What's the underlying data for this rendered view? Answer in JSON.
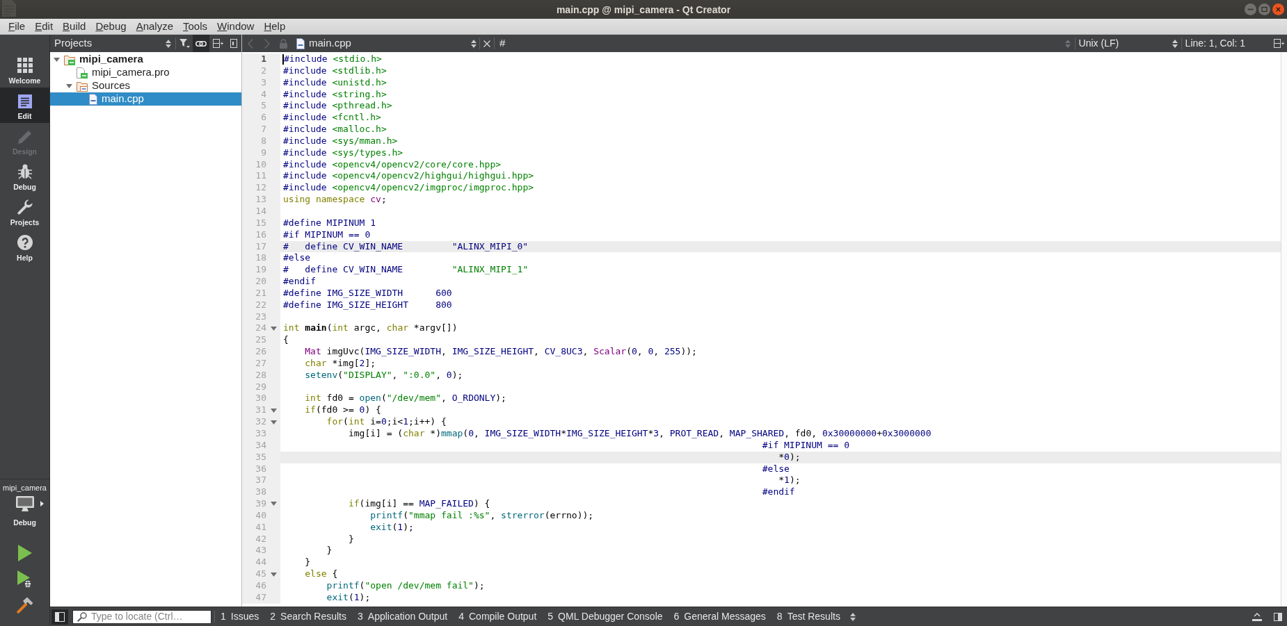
{
  "window": {
    "title": "main.cpp @ mipi_camera - Qt Creator"
  },
  "menu": [
    "File",
    "Edit",
    "Build",
    "Debug",
    "Analyze",
    "Tools",
    "Window",
    "Help"
  ],
  "mode_bar": {
    "modes": [
      {
        "label": "Welcome",
        "kind": "welcome",
        "selected": false,
        "disabled": false
      },
      {
        "label": "Edit",
        "kind": "edit",
        "selected": true,
        "disabled": false
      },
      {
        "label": "Design",
        "kind": "design",
        "selected": false,
        "disabled": true
      },
      {
        "label": "Debug",
        "kind": "debug",
        "selected": false,
        "disabled": false
      },
      {
        "label": "Projects",
        "kind": "projects",
        "selected": false,
        "disabled": false
      },
      {
        "label": "Help",
        "kind": "help",
        "selected": false,
        "disabled": false
      }
    ],
    "kit": {
      "project": "mipi_camera",
      "build": "Debug"
    }
  },
  "projects_panel": {
    "view": "Projects",
    "link_button": {
      "checked": true
    },
    "tree": [
      {
        "label": "mipi_camera",
        "kind": "project",
        "expanded": true,
        "selected": false,
        "children": [
          {
            "label": "mipi_camera.pro",
            "kind": "qmake",
            "selected": false
          },
          {
            "label": "Sources",
            "kind": "folder",
            "expanded": true,
            "selected": false,
            "children": [
              {
                "label": "main.cpp",
                "kind": "source",
                "selected": true
              }
            ]
          }
        ]
      }
    ]
  },
  "editor": {
    "document": "main.cpp",
    "symbol": "#",
    "line_ending": "Unix (LF)",
    "position": "Line: 1, Col: 1",
    "back": {
      "disabled": true
    },
    "forward": {
      "disabled": true
    },
    "lines": [
      {
        "number": "1",
        "current": true,
        "disabled": false,
        "foldable": false,
        "tokens": [
          {
            "kind": "preprocessor",
            "text": "#include "
          },
          {
            "kind": "string",
            "text": "<stdio.h>"
          }
        ]
      },
      {
        "number": "2",
        "current": false,
        "disabled": false,
        "foldable": false,
        "tokens": [
          {
            "kind": "preprocessor",
            "text": "#include "
          },
          {
            "kind": "string",
            "text": "<stdlib.h>"
          }
        ]
      },
      {
        "number": "3",
        "current": false,
        "disabled": false,
        "foldable": false,
        "tokens": [
          {
            "kind": "preprocessor",
            "text": "#include "
          },
          {
            "kind": "string",
            "text": "<unistd.h>"
          }
        ]
      },
      {
        "number": "4",
        "current": false,
        "disabled": false,
        "foldable": false,
        "tokens": [
          {
            "kind": "preprocessor",
            "text": "#include "
          },
          {
            "kind": "string",
            "text": "<string.h>"
          }
        ]
      },
      {
        "number": "5",
        "current": false,
        "disabled": false,
        "foldable": false,
        "tokens": [
          {
            "kind": "preprocessor",
            "text": "#include "
          },
          {
            "kind": "string",
            "text": "<pthread.h>"
          }
        ]
      },
      {
        "number": "6",
        "current": false,
        "disabled": false,
        "foldable": false,
        "tokens": [
          {
            "kind": "preprocessor",
            "text": "#include "
          },
          {
            "kind": "string",
            "text": "<fcntl.h>"
          }
        ]
      },
      {
        "number": "7",
        "current": false,
        "disabled": false,
        "foldable": false,
        "tokens": [
          {
            "kind": "preprocessor",
            "text": "#include "
          },
          {
            "kind": "string",
            "text": "<malloc.h>"
          }
        ]
      },
      {
        "number": "8",
        "current": false,
        "disabled": false,
        "foldable": false,
        "tokens": [
          {
            "kind": "preprocessor",
            "text": "#include "
          },
          {
            "kind": "string",
            "text": "<sys/mman.h>"
          }
        ]
      },
      {
        "number": "9",
        "current": false,
        "disabled": false,
        "foldable": false,
        "tokens": [
          {
            "kind": "preprocessor",
            "text": "#include "
          },
          {
            "kind": "string",
            "text": "<sys/types.h>"
          }
        ]
      },
      {
        "number": "10",
        "current": false,
        "disabled": false,
        "foldable": false,
        "tokens": [
          {
            "kind": "preprocessor",
            "text": "#include "
          },
          {
            "kind": "string",
            "text": "<opencv4/opencv2/core/core.hpp>"
          }
        ]
      },
      {
        "number": "11",
        "current": false,
        "disabled": false,
        "foldable": false,
        "tokens": [
          {
            "kind": "preprocessor",
            "text": "#include "
          },
          {
            "kind": "string",
            "text": "<opencv4/opencv2/highgui/highgui.hpp>"
          }
        ]
      },
      {
        "number": "12",
        "current": false,
        "disabled": false,
        "foldable": false,
        "tokens": [
          {
            "kind": "preprocessor",
            "text": "#include "
          },
          {
            "kind": "string",
            "text": "<opencv4/opencv2/imgproc/imgproc.hpp>"
          }
        ]
      },
      {
        "number": "13",
        "current": false,
        "disabled": false,
        "foldable": false,
        "tokens": [
          {
            "kind": "keyword",
            "text": "using namespace "
          },
          {
            "kind": "type",
            "text": "cv"
          },
          {
            "kind": "plain",
            "text": ";"
          }
        ]
      },
      {
        "number": "14",
        "current": false,
        "disabled": false,
        "foldable": false
      },
      {
        "number": "15",
        "current": false,
        "disabled": false,
        "foldable": false,
        "tokens": [
          {
            "kind": "preprocessor",
            "text": "#define MIPINUM 1"
          }
        ]
      },
      {
        "number": "16",
        "current": false,
        "disabled": false,
        "foldable": false,
        "tokens": [
          {
            "kind": "preprocessor",
            "text": "#if MIPINUM == 0"
          }
        ]
      },
      {
        "number": "17",
        "current": false,
        "disabled": true,
        "foldable": false,
        "tokens": [
          {
            "kind": "preprocessor",
            "text": "#   define CV_WIN_NAME         \"ALINX_MIPI_0\""
          }
        ]
      },
      {
        "number": "18",
        "current": false,
        "disabled": false,
        "foldable": false,
        "tokens": [
          {
            "kind": "preprocessor",
            "text": "#else"
          }
        ]
      },
      {
        "number": "19",
        "current": false,
        "disabled": false,
        "foldable": false,
        "tokens": [
          {
            "kind": "preprocessor",
            "text": "#   define CV_WIN_NAME         "
          },
          {
            "kind": "string",
            "text": "\"ALINX_MIPI_1\""
          }
        ]
      },
      {
        "number": "20",
        "current": false,
        "disabled": false,
        "foldable": false,
        "tokens": [
          {
            "kind": "preprocessor",
            "text": "#endif"
          }
        ]
      },
      {
        "number": "21",
        "current": false,
        "disabled": false,
        "foldable": false,
        "tokens": [
          {
            "kind": "preprocessor",
            "text": "#define IMG_SIZE_WIDTH      600"
          }
        ]
      },
      {
        "number": "22",
        "current": false,
        "disabled": false,
        "foldable": false,
        "tokens": [
          {
            "kind": "preprocessor",
            "text": "#define IMG_SIZE_HEIGHT     800"
          }
        ]
      },
      {
        "number": "23",
        "current": false,
        "disabled": false,
        "foldable": false
      },
      {
        "number": "24",
        "current": false,
        "disabled": false,
        "foldable": true,
        "tokens": [
          {
            "kind": "keyword",
            "text": "int "
          },
          {
            "kind": "declaration",
            "text": "main"
          },
          {
            "kind": "plain",
            "text": "("
          },
          {
            "kind": "keyword",
            "text": "int"
          },
          {
            "kind": "plain",
            "text": " argc, "
          },
          {
            "kind": "keyword",
            "text": "char"
          },
          {
            "kind": "plain",
            "text": " *argv[])"
          }
        ]
      },
      {
        "number": "25",
        "current": false,
        "disabled": false,
        "foldable": false,
        "tokens": [
          {
            "kind": "plain",
            "text": "{"
          }
        ]
      },
      {
        "number": "26",
        "current": false,
        "disabled": false,
        "foldable": false,
        "tokens": [
          {
            "kind": "type",
            "text": "    Mat"
          },
          {
            "kind": "plain",
            "text": " imgUvc("
          },
          {
            "kind": "preprocessor",
            "text": "IMG_SIZE_WIDTH"
          },
          {
            "kind": "plain",
            "text": ", "
          },
          {
            "kind": "preprocessor",
            "text": "IMG_SIZE_HEIGHT"
          },
          {
            "kind": "plain",
            "text": ", "
          },
          {
            "kind": "preprocessor",
            "text": "CV_8UC3"
          },
          {
            "kind": "plain",
            "text": ", "
          },
          {
            "kind": "type",
            "text": "Scalar"
          },
          {
            "kind": "plain",
            "text": "("
          },
          {
            "kind": "number",
            "text": "0"
          },
          {
            "kind": "plain",
            "text": ", "
          },
          {
            "kind": "number",
            "text": "0"
          },
          {
            "kind": "plain",
            "text": ", "
          },
          {
            "kind": "number",
            "text": "255"
          },
          {
            "kind": "plain",
            "text": "));"
          }
        ]
      },
      {
        "number": "27",
        "current": false,
        "disabled": false,
        "foldable": false,
        "tokens": [
          {
            "kind": "keyword",
            "text": "    char"
          },
          {
            "kind": "plain",
            "text": " *img["
          },
          {
            "kind": "number",
            "text": "2"
          },
          {
            "kind": "plain",
            "text": "];"
          }
        ]
      },
      {
        "number": "28",
        "current": false,
        "disabled": false,
        "foldable": false,
        "tokens": [
          {
            "kind": "function",
            "text": "    setenv"
          },
          {
            "kind": "plain",
            "text": "("
          },
          {
            "kind": "string",
            "text": "\"DISPLAY\""
          },
          {
            "kind": "plain",
            "text": ", "
          },
          {
            "kind": "string",
            "text": "\":0.0\""
          },
          {
            "kind": "plain",
            "text": ", "
          },
          {
            "kind": "number",
            "text": "0"
          },
          {
            "kind": "plain",
            "text": ");"
          }
        ]
      },
      {
        "number": "29",
        "current": false,
        "disabled": false,
        "foldable": false
      },
      {
        "number": "30",
        "current": false,
        "disabled": false,
        "foldable": false,
        "tokens": [
          {
            "kind": "keyword",
            "text": "    int"
          },
          {
            "kind": "plain",
            "text": " fd0 = "
          },
          {
            "kind": "function",
            "text": "open"
          },
          {
            "kind": "plain",
            "text": "("
          },
          {
            "kind": "string",
            "text": "\"/dev/mem\""
          },
          {
            "kind": "plain",
            "text": ", "
          },
          {
            "kind": "preprocessor",
            "text": "O_RDONLY"
          },
          {
            "kind": "plain",
            "text": ");"
          }
        ]
      },
      {
        "number": "31",
        "current": false,
        "disabled": false,
        "foldable": true,
        "tokens": [
          {
            "kind": "keyword",
            "text": "    if"
          },
          {
            "kind": "plain",
            "text": "(fd0 >= "
          },
          {
            "kind": "number",
            "text": "0"
          },
          {
            "kind": "plain",
            "text": ") {"
          }
        ]
      },
      {
        "number": "32",
        "current": false,
        "disabled": false,
        "foldable": true,
        "tokens": [
          {
            "kind": "keyword",
            "text": "        for"
          },
          {
            "kind": "plain",
            "text": "("
          },
          {
            "kind": "keyword",
            "text": "int"
          },
          {
            "kind": "plain",
            "text": " i="
          },
          {
            "kind": "number",
            "text": "0"
          },
          {
            "kind": "plain",
            "text": ";i<"
          },
          {
            "kind": "number",
            "text": "1"
          },
          {
            "kind": "plain",
            "text": ";i++) {"
          }
        ]
      },
      {
        "number": "33",
        "current": false,
        "disabled": false,
        "foldable": false,
        "tokens": [
          {
            "kind": "plain",
            "text": "            img[i] = ("
          },
          {
            "kind": "keyword",
            "text": "char"
          },
          {
            "kind": "plain",
            "text": " *)"
          },
          {
            "kind": "function",
            "text": "mmap"
          },
          {
            "kind": "plain",
            "text": "("
          },
          {
            "kind": "number",
            "text": "0"
          },
          {
            "kind": "plain",
            "text": ", "
          },
          {
            "kind": "preprocessor",
            "text": "IMG_SIZE_WIDTH"
          },
          {
            "kind": "plain",
            "text": "*"
          },
          {
            "kind": "preprocessor",
            "text": "IMG_SIZE_HEIGHT"
          },
          {
            "kind": "plain",
            "text": "*"
          },
          {
            "kind": "number",
            "text": "3"
          },
          {
            "kind": "plain",
            "text": ", "
          },
          {
            "kind": "preprocessor",
            "text": "PROT_READ"
          },
          {
            "kind": "plain",
            "text": ", "
          },
          {
            "kind": "preprocessor",
            "text": "MAP_SHARED"
          },
          {
            "kind": "plain",
            "text": ", fd0, "
          },
          {
            "kind": "number",
            "text": "0x30000000"
          },
          {
            "kind": "plain",
            "text": "+"
          },
          {
            "kind": "number",
            "text": "0x3000000"
          }
        ]
      },
      {
        "number": "34",
        "current": false,
        "disabled": false,
        "foldable": false,
        "tokens": [
          {
            "kind": "preprocessor",
            "text": "                                                                                        #if MIPINUM == 0"
          }
        ]
      },
      {
        "number": "35",
        "current": false,
        "disabled": true,
        "foldable": false,
        "tokens": [
          {
            "kind": "plain",
            "text": "                                                                                           *"
          },
          {
            "kind": "number",
            "text": "0"
          },
          {
            "kind": "plain",
            "text": ");"
          }
        ]
      },
      {
        "number": "36",
        "current": false,
        "disabled": false,
        "foldable": false,
        "tokens": [
          {
            "kind": "preprocessor",
            "text": "                                                                                        #else"
          }
        ]
      },
      {
        "number": "37",
        "current": false,
        "disabled": false,
        "foldable": false,
        "tokens": [
          {
            "kind": "plain",
            "text": "                                                                                           *"
          },
          {
            "kind": "number",
            "text": "1"
          },
          {
            "kind": "plain",
            "text": ");"
          }
        ]
      },
      {
        "number": "38",
        "current": false,
        "disabled": false,
        "foldable": false,
        "tokens": [
          {
            "kind": "preprocessor",
            "text": "                                                                                        #endif"
          }
        ]
      },
      {
        "number": "39",
        "current": false,
        "disabled": false,
        "foldable": true,
        "tokens": [
          {
            "kind": "keyword",
            "text": "            if"
          },
          {
            "kind": "plain",
            "text": "(img[i] == "
          },
          {
            "kind": "preprocessor",
            "text": "MAP_FAILED"
          },
          {
            "kind": "plain",
            "text": ") {"
          }
        ]
      },
      {
        "number": "40",
        "current": false,
        "disabled": false,
        "foldable": false,
        "tokens": [
          {
            "kind": "function",
            "text": "                printf"
          },
          {
            "kind": "plain",
            "text": "("
          },
          {
            "kind": "string",
            "text": "\"mmap fail :%s\""
          },
          {
            "kind": "plain",
            "text": ", "
          },
          {
            "kind": "function",
            "text": "strerror"
          },
          {
            "kind": "plain",
            "text": "(errno));"
          }
        ]
      },
      {
        "number": "41",
        "current": false,
        "disabled": false,
        "foldable": false,
        "tokens": [
          {
            "kind": "function",
            "text": "                exit"
          },
          {
            "kind": "plain",
            "text": "("
          },
          {
            "kind": "number",
            "text": "1"
          },
          {
            "kind": "plain",
            "text": ");"
          }
        ]
      },
      {
        "number": "42",
        "current": false,
        "disabled": false,
        "foldable": false,
        "tokens": [
          {
            "kind": "plain",
            "text": "            }"
          }
        ]
      },
      {
        "number": "43",
        "current": false,
        "disabled": false,
        "foldable": false,
        "tokens": [
          {
            "kind": "plain",
            "text": "        }"
          }
        ]
      },
      {
        "number": "44",
        "current": false,
        "disabled": false,
        "foldable": false,
        "tokens": [
          {
            "kind": "plain",
            "text": "    }"
          }
        ]
      },
      {
        "number": "45",
        "current": false,
        "disabled": false,
        "foldable": true,
        "tokens": [
          {
            "kind": "keyword",
            "text": "    else"
          },
          {
            "kind": "plain",
            "text": " {"
          }
        ]
      },
      {
        "number": "46",
        "current": false,
        "disabled": false,
        "foldable": false,
        "tokens": [
          {
            "kind": "function",
            "text": "        printf"
          },
          {
            "kind": "plain",
            "text": "("
          },
          {
            "kind": "string",
            "text": "\"open /dev/mem fail\""
          },
          {
            "kind": "plain",
            "text": ");"
          }
        ]
      },
      {
        "number": "47",
        "current": false,
        "disabled": false,
        "foldable": false,
        "tokens": [
          {
            "kind": "function",
            "text": "        exit"
          },
          {
            "kind": "plain",
            "text": "("
          },
          {
            "kind": "number",
            "text": "1"
          },
          {
            "kind": "plain",
            "text": ");"
          }
        ]
      }
    ]
  },
  "status_bar": {
    "sidebar_toggle": {
      "checked": true
    },
    "locator": {
      "placeholder": "Type to locate (Ctrl…"
    },
    "panes": [
      {
        "number": "1",
        "label": "Issues"
      },
      {
        "number": "2",
        "label": "Search Results"
      },
      {
        "number": "3",
        "label": "Application Output"
      },
      {
        "number": "4",
        "label": "Compile Output"
      },
      {
        "number": "5",
        "label": "QML Debugger Console"
      },
      {
        "number": "6",
        "label": "General Messages"
      },
      {
        "number": "8",
        "label": "Test Results"
      }
    ]
  }
}
